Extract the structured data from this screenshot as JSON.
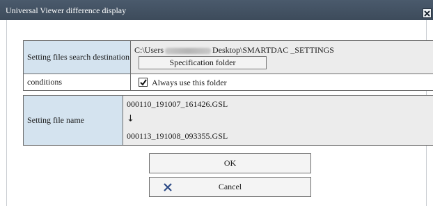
{
  "window": {
    "title": "Universal Viewer difference display",
    "close_glyph": "×"
  },
  "settings": {
    "search_destination_label": "Setting files search destination",
    "path_prefix": "C:\\Users",
    "path_suffix": "Desktop\\SMARTDAC _SETTINGS",
    "specification_folder_button": "Specification folder"
  },
  "conditions": {
    "label": "conditions",
    "always_use_folder": {
      "label": "Always use this folder",
      "checked": true
    }
  },
  "setting_file": {
    "label": "Setting file name",
    "from_file": "000110_191007_161426.GSL",
    "arrow": "↓",
    "to_file": "000113_191008_093355.GSL"
  },
  "buttons": {
    "ok": "OK",
    "cancel": "Cancel"
  },
  "colors": {
    "titlebar": "#45566a",
    "label_cell": "#d4e3ef",
    "value_cell": "#ececec",
    "cancel_icon": "#2c4a86"
  },
  "icons": {
    "close": "close-icon",
    "checkmark": "checkmark-icon",
    "cancel": "cancel-x-icon"
  }
}
